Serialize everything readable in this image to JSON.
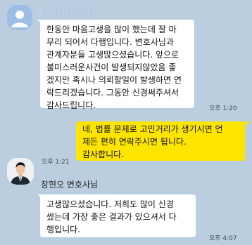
{
  "messages": [
    {
      "sender": "other",
      "lines": [
        "한동안 마음고생을 많이 했는데 잘 마",
        "무리 되어서 다행입니다. 변호사님과",
        "관계자분들 고생많으셨습니다. 앞으로",
        "불미스러운사건이 발생되지않았음 좋",
        "겠지만 혹시나 의뢰할일이 발생하면 연",
        "락드리겠습니다. 그동안 신경써주셔서",
        "감사드립니다."
      ],
      "time": "오후 1:20"
    },
    {
      "sender": "me",
      "lines": [
        "네, 법률 문제로 고민거리가 생기시면 언",
        "제든 편히 연락주시면 됩니다.",
        "감사합니다."
      ],
      "time": "오후 1:21"
    },
    {
      "sender": "lawyer",
      "name": "장현오 변호사님",
      "lines": [
        "고생많으셨습니다. 저희도 많이 신경",
        "썼는데 가장 좋은 결과가 있으셔서 다",
        "행입니다."
      ],
      "time": "오후 4:07"
    }
  ],
  "colors": {
    "background": "#bacee0",
    "my_bubble": "#fee500",
    "other_bubble": "#ffffff"
  },
  "icons": {
    "default_avatar": "person-silhouette-icon",
    "lawyer_avatar": "profile-photo"
  }
}
